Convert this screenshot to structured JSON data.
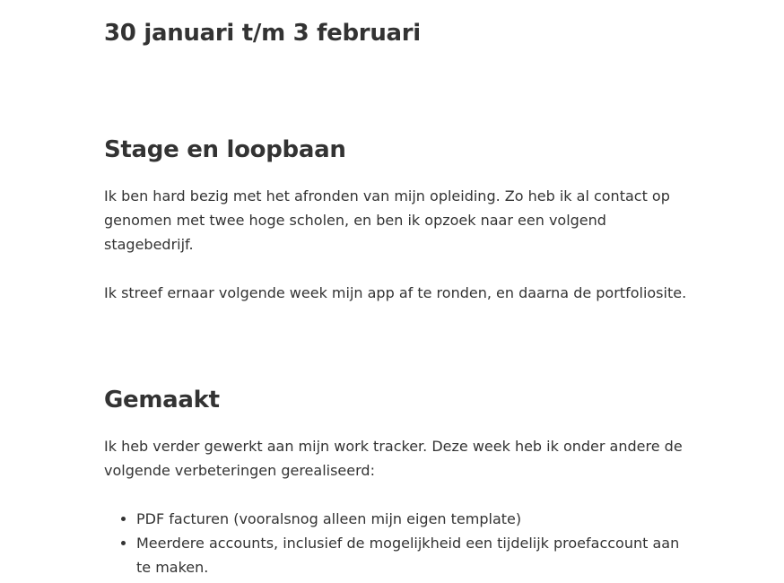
{
  "title": "30 januari t/m 3 februari",
  "sections": [
    {
      "heading": "Stage en loopbaan",
      "paragraphs": [
        "Ik ben hard bezig met het afronden van mijn opleiding. Zo heb ik al contact op genomen met twee hoge scholen, en ben ik opzoek naar een volgend stagebedrijf.",
        "Ik streef ernaar volgende week mijn app af te ronden, en daarna de portfoliosite."
      ]
    },
    {
      "heading": "Gemaakt",
      "paragraphs": [
        "Ik heb verder gewerkt aan mijn work tracker. Deze week heb ik onder andere de volgende verbeteringen gerealiseerd:"
      ],
      "list": [
        "PDF facturen (vooralsnog alleen mijn eigen template)",
        "Meerdere accounts, inclusief de mogelijkheid een tijdelijk proefaccount aan te maken."
      ]
    }
  ]
}
